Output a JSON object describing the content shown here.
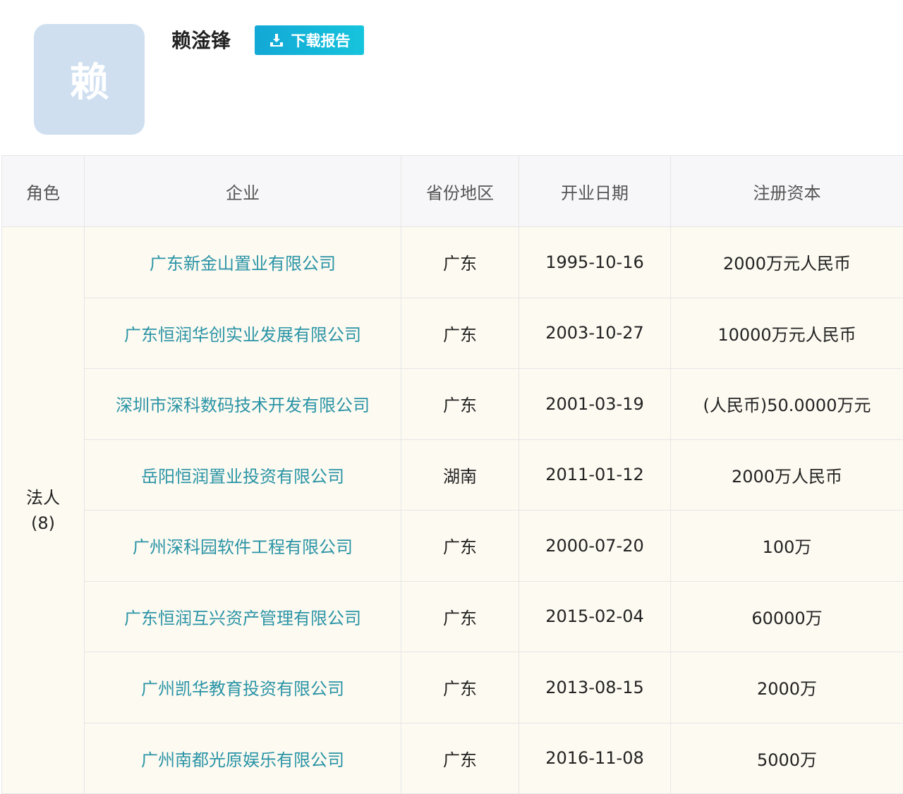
{
  "profile": {
    "avatar_char": "赖",
    "name": "赖淦锋",
    "download_label": "下载报告",
    "download_icon": "download-icon"
  },
  "table": {
    "headers": [
      "角色",
      "企业",
      "省份地区",
      "开业日期",
      "注册资本"
    ],
    "role": {
      "label": "法人",
      "count": "(8)"
    },
    "rows": [
      {
        "company": "广东新金山置业有限公司",
        "region": "广东",
        "date": "1995-10-16",
        "capital": "2000万元人民币"
      },
      {
        "company": "广东恒润华创实业发展有限公司",
        "region": "广东",
        "date": "2003-10-27",
        "capital": "10000万元人民币"
      },
      {
        "company": "深圳市深科数码技术开发有限公司",
        "region": "广东",
        "date": "2001-03-19",
        "capital": "(人民币)50.0000万元"
      },
      {
        "company": "岳阳恒润置业投资有限公司",
        "region": "湖南",
        "date": "2011-01-12",
        "capital": "2000万人民币"
      },
      {
        "company": "广州深科园软件工程有限公司",
        "region": "广东",
        "date": "2000-07-20",
        "capital": "100万"
      },
      {
        "company": "广东恒润互兴资产管理有限公司",
        "region": "广东",
        "date": "2015-02-04",
        "capital": "60000万"
      },
      {
        "company": "广州凯华教育投资有限公司",
        "region": "广东",
        "date": "2013-08-15",
        "capital": "2000万"
      },
      {
        "company": "广州南都光原娱乐有限公司",
        "region": "广东",
        "date": "2016-11-08",
        "capital": "5000万"
      }
    ]
  }
}
